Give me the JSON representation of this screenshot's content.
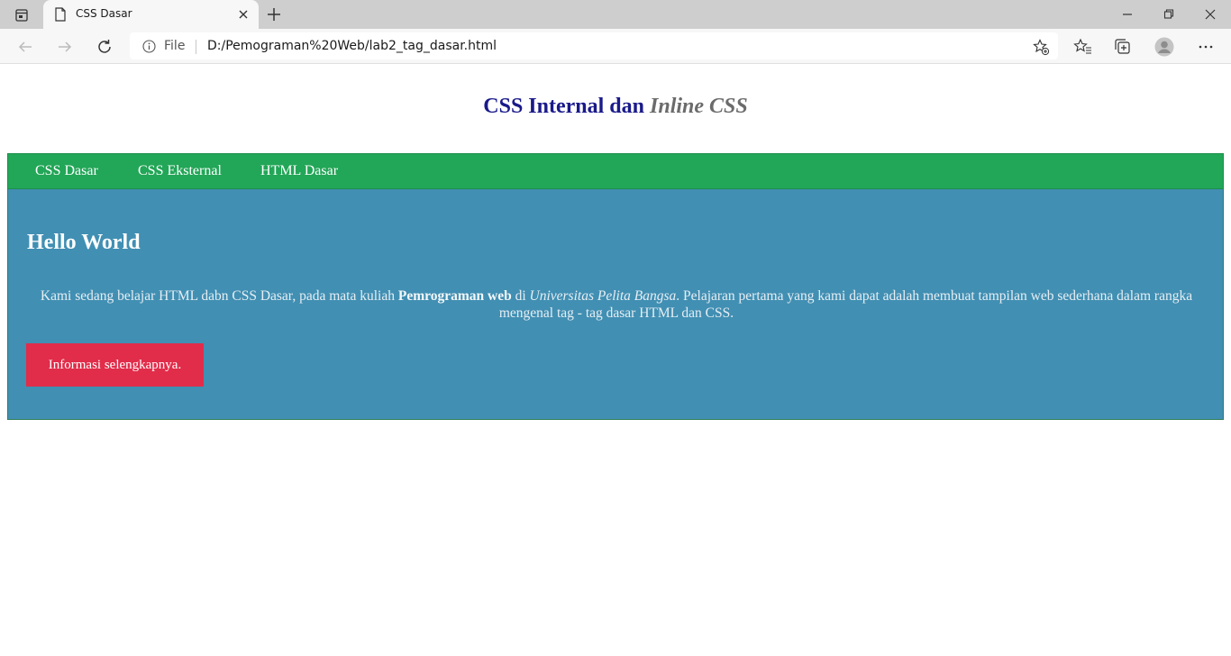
{
  "browser": {
    "tab_title": "CSS Dasar",
    "address_prefix": "File",
    "url": "D:/Pemograman%20Web/lab2_tag_dasar.html"
  },
  "page": {
    "heading_main": "CSS Internal dan",
    "heading_italic": "Inline CSS",
    "nav": [
      "CSS Dasar",
      "CSS Eksternal",
      "HTML Dasar"
    ],
    "section_title": "Hello World",
    "paragraph_part1": "Kami sedang belajar HTML dabn CSS Dasar, pada mata kuliah",
    "paragraph_bold": "Pemrograman web",
    "paragraph_part2": "di",
    "paragraph_italic": "Universitas Pelita Bangsa",
    "paragraph_part3": ". Pelajaran pertama yang kami dapat adalah membuat tampilan web sederhana dalam rangka mengenal tag - tag dasar HTML dan CSS.",
    "button_label": "Informasi selengkapnya."
  },
  "colors": {
    "heading": "#1a1a8a",
    "navbar": "#22a657",
    "content_bg": "#418fb3",
    "button": "#e12c4a"
  }
}
